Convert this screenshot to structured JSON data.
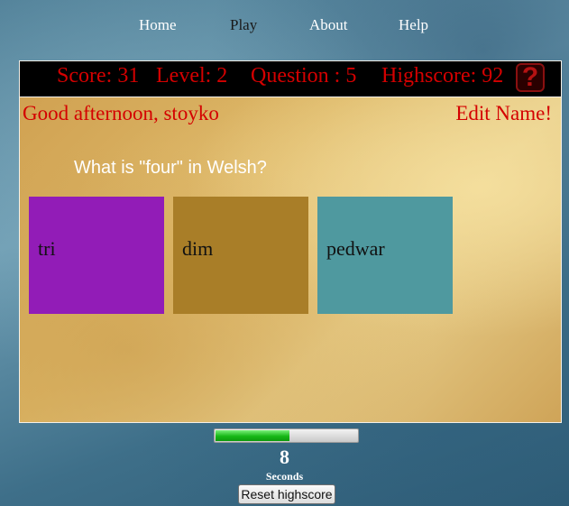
{
  "nav": {
    "items": [
      {
        "label": "Home"
      },
      {
        "label": "Play"
      },
      {
        "label": "About"
      },
      {
        "label": "Help"
      }
    ]
  },
  "scoreboard": {
    "score": "Score: 31",
    "level": "Level: 2",
    "question": "Question : 5",
    "highscore": "Highscore: 92",
    "help_icon": "?"
  },
  "greeting": "Good afternoon, stoyko",
  "edit_name": "Edit Name!",
  "quiz": {
    "question": "What is \"four\" in Welsh?",
    "answers": [
      {
        "label": "tri",
        "color": "#921cb7"
      },
      {
        "label": "dim",
        "color": "#a97e28"
      },
      {
        "label": "pedwar",
        "color": "#4f999f"
      }
    ]
  },
  "timer": {
    "value": "8",
    "unit": "Seconds",
    "progress_percent": 53,
    "color": "#16b816"
  },
  "reset_button": "Reset highscore"
}
